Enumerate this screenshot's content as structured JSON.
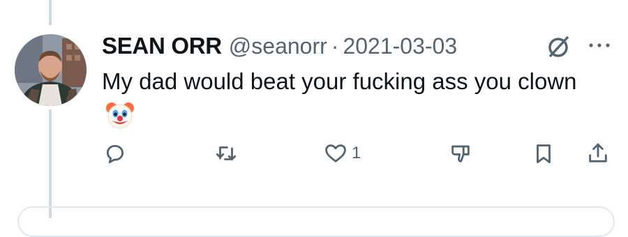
{
  "tweet": {
    "author_name": "SEAN ORR",
    "handle": "@seanorr",
    "separator": "·",
    "date": "2021-03-03",
    "text": "My dad would beat your fucking ass you clown",
    "emoji": "clown-face-emoji"
  },
  "actions": {
    "reply_count": "",
    "retweet_count": "",
    "like_count": "1"
  },
  "icons": {
    "reply": "reply-icon",
    "retweet": "retweet-icon",
    "like": "heart-icon",
    "dislike": "thumbs-down-icon",
    "bookmark": "bookmark-icon",
    "share": "share-icon",
    "grok": "grok-icon",
    "more": "more-icon"
  },
  "colors": {
    "text": "#0f1419",
    "secondary": "#536471",
    "thread_line": "#cfd9de"
  }
}
